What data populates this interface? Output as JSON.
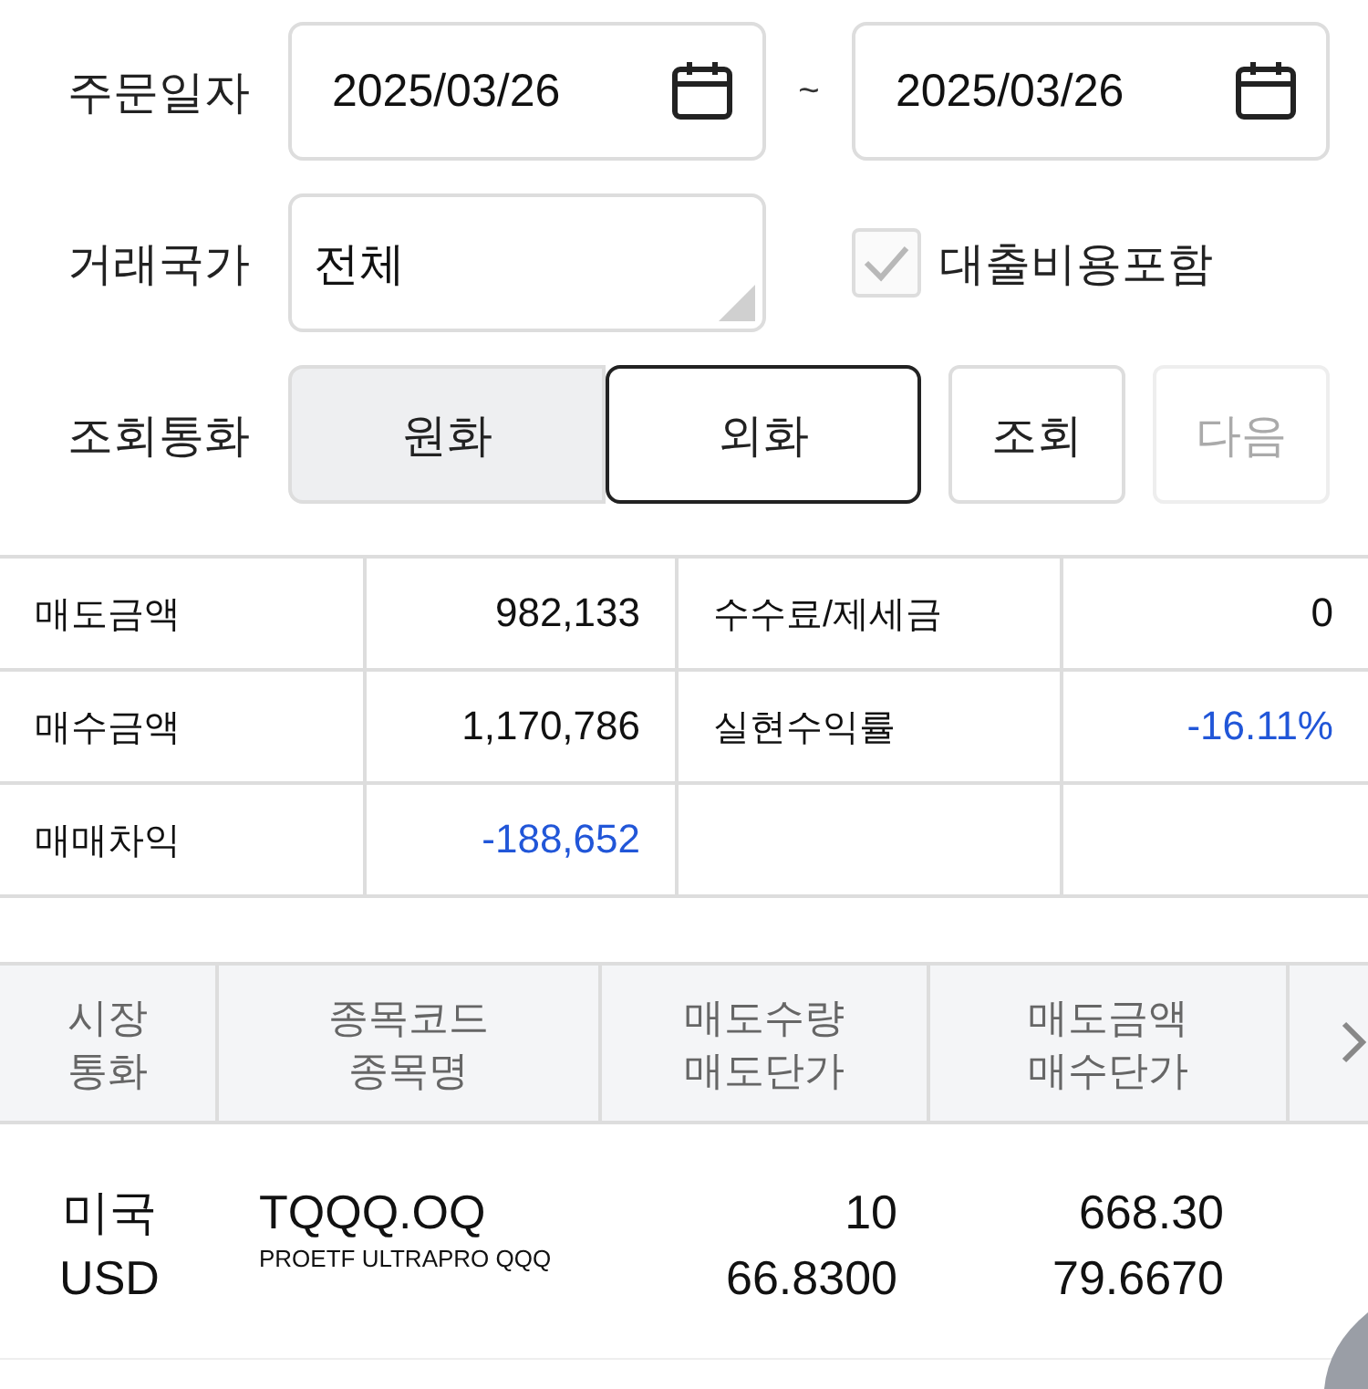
{
  "filters": {
    "order_date": {
      "label": "주문일자",
      "from": "2025/03/26",
      "separator": "~",
      "to": "2025/03/26"
    },
    "country": {
      "label": "거래국가",
      "value": "전체"
    },
    "loan_cost": {
      "label": "대출비용포함",
      "checked": true,
      "disabled": true
    },
    "currency": {
      "label": "조회통화",
      "options": [
        {
          "label": "원화",
          "selected": false
        },
        {
          "label": "외화",
          "selected": true
        }
      ]
    },
    "buttons": [
      {
        "label": "조회",
        "disabled": false
      },
      {
        "label": "다음",
        "disabled": true
      }
    ]
  },
  "summary": [
    [
      {
        "label": "매도금액",
        "value": "982,133",
        "negative": false
      },
      {
        "label": "수수료/제세금",
        "value": "0",
        "negative": false
      }
    ],
    [
      {
        "label": "매수금액",
        "value": "1,170,786",
        "negative": false
      },
      {
        "label": "실현수익률",
        "value": "-16.11%",
        "negative": true
      }
    ],
    [
      {
        "label": "매매차익",
        "value": "-188,652",
        "negative": true
      }
    ]
  ],
  "holdings": {
    "columns": [
      [
        "시장",
        "통화"
      ],
      [
        "종목코드",
        "종목명"
      ],
      [
        "매도수량",
        "매도단가"
      ],
      [
        "매도금액",
        "매수단가"
      ]
    ],
    "rows": [
      {
        "market": "미국",
        "currency": "USD",
        "code": "TQQQ.OQ",
        "name": "PROETF ULTRAPRO QQQ",
        "sell_qty": "10",
        "sell_price": "66.8300",
        "sell_amount": "668.30",
        "buy_price": "79.6670"
      }
    ]
  }
}
